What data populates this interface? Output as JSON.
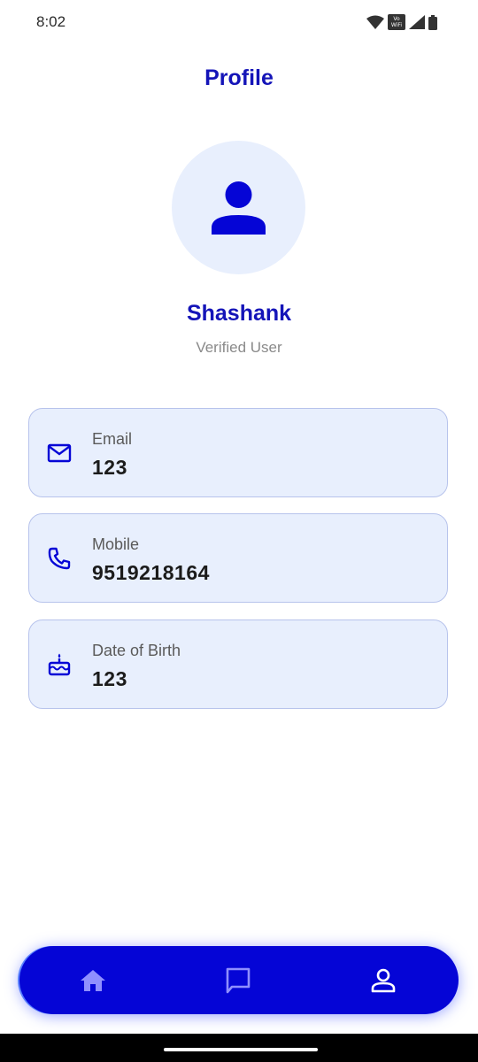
{
  "status_bar": {
    "time": "8:02",
    "vowifi_top": "Vo",
    "vowifi_bottom": "WiFi"
  },
  "header": {
    "title": "Profile"
  },
  "user": {
    "name": "Shashank",
    "status": "Verified User"
  },
  "fields": [
    {
      "label": "Email",
      "value": "123",
      "icon": "mail-icon"
    },
    {
      "label": "Mobile",
      "value": "9519218164",
      "icon": "phone-icon"
    },
    {
      "label": "Date of Birth",
      "value": "123",
      "icon": "cake-icon"
    }
  ],
  "nav": {
    "items": [
      "home-icon",
      "chat-icon",
      "profile-icon"
    ],
    "active": "profile-icon"
  },
  "colors": {
    "accent": "#1414b8",
    "card_bg": "#e8effd",
    "nav_bg": "#0505d6"
  }
}
